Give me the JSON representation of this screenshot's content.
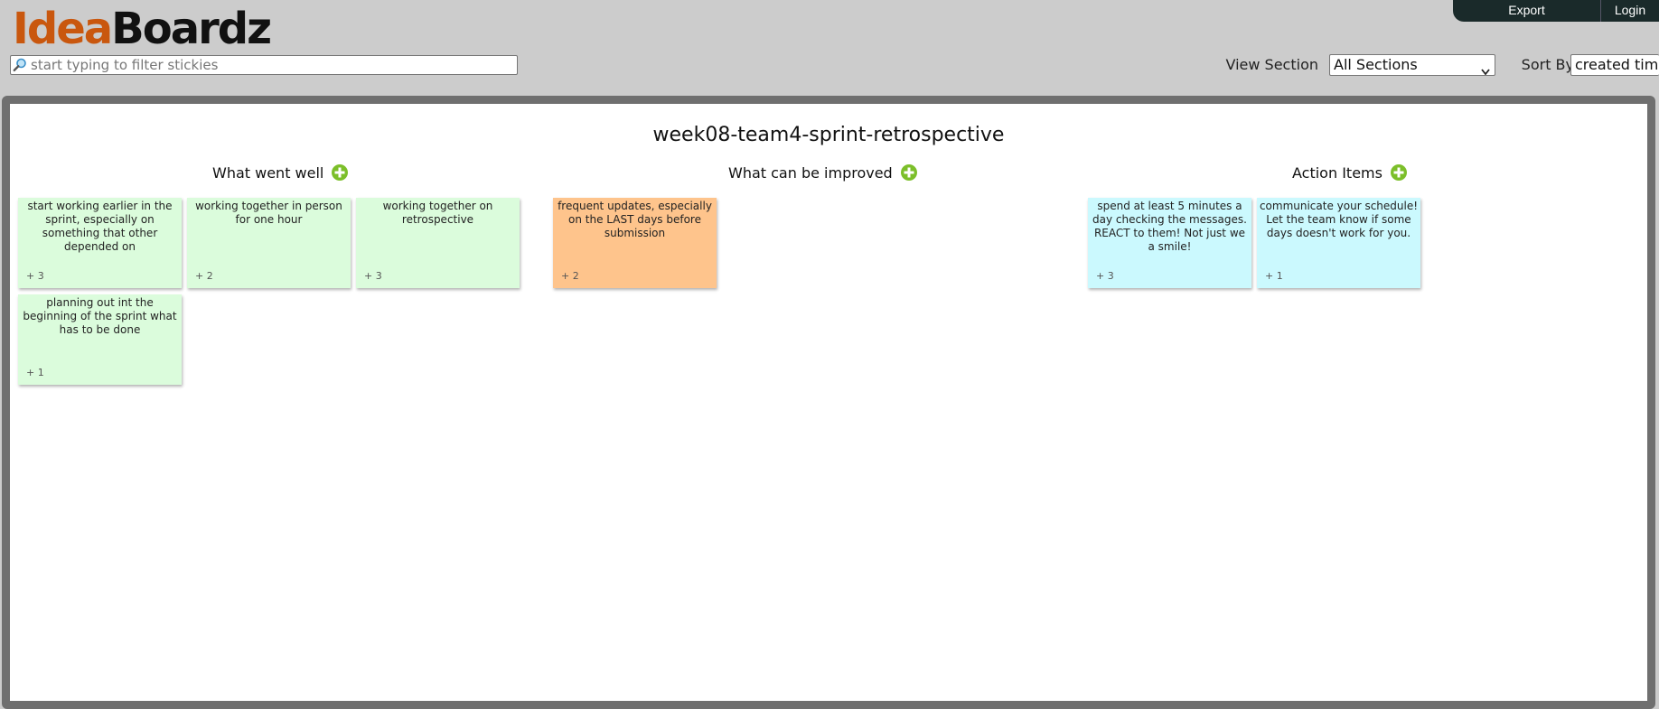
{
  "app": {
    "logo_part1": "Idea",
    "logo_part2": "Boardz",
    "export_label": "Export",
    "login_label": "Login"
  },
  "filter": {
    "placeholder": "start typing to filter stickies",
    "value": ""
  },
  "controls": {
    "view_section_label": "View Section",
    "view_section_value": "All Sections",
    "sort_by_label": "Sort By",
    "sort_by_value": "created time"
  },
  "board": {
    "title": "week08-team4-sprint-retrospective",
    "sections": [
      {
        "name": "What went well",
        "color": "#dbfcdc",
        "stickies": [
          {
            "text": "start working earlier in the sprint, especially on something that other depended on",
            "votes": "+ 3"
          },
          {
            "text": "working together in person for one hour",
            "votes": "+ 2"
          },
          {
            "text": "working together on retrospective",
            "votes": "+ 3"
          },
          {
            "text": "planning out int the beginning of the sprint what has to be done",
            "votes": "+ 1"
          }
        ]
      },
      {
        "name": "What can be improved",
        "color": "#fec48c",
        "stickies": [
          {
            "text": "frequent updates, especially on the LAST days before submission",
            "votes": "+ 2"
          }
        ]
      },
      {
        "name": "Action Items",
        "color": "#cbf9fe",
        "stickies": [
          {
            "text": "spend at least 5 minutes a day checking the messages. REACT to them! Not just we a smile!",
            "votes": "+ 3"
          },
          {
            "text": "communicate your schedule! Let the team know if some days doesn't work for you.",
            "votes": "+ 1"
          }
        ]
      }
    ]
  },
  "colors": {
    "accent_add": "#7cbf2a",
    "logo_orange": "#c9570e",
    "board_border": "#6f6f6f"
  },
  "icons": {
    "search": "search-icon",
    "add": "plus-circle-icon",
    "dropdown": "chevron-down-icon"
  }
}
